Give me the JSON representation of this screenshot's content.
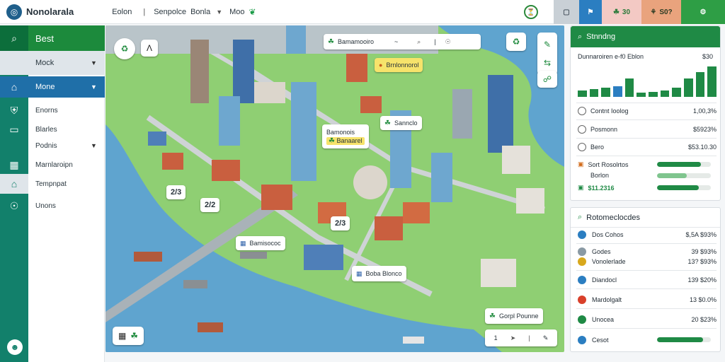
{
  "app": {
    "title": "Nonolarala"
  },
  "topnav": {
    "item1": "Eolon",
    "item2": "Senpolce",
    "item3": "Bonla",
    "item4": "Moo"
  },
  "toolbar": {
    "pink_label": "30",
    "orange_label": "S0?",
    "colors": {
      "gray": "#c9d0d6",
      "blue": "#2b7ec1",
      "pink": "#f3c9c4",
      "orange": "#e9a37d",
      "green": "#2e9e45"
    }
  },
  "sidebar": {
    "best": "Best",
    "mock": "Mock",
    "menu": "Mone",
    "items": [
      "Enorns",
      "Blarles",
      "Podnis",
      "Marnlaroipn",
      "Tempnpat",
      "Unons"
    ]
  },
  "map": {
    "top_pill": "Bamamooiro",
    "yellow_pill": "Brnlonnorol",
    "label_a": "Bamonois",
    "label_b": "Banaarel",
    "label_c": "Sannclo",
    "tag_1": "2/3",
    "tag_2": "2/2",
    "tag_3": "2/3",
    "label_d": "Bamisococ",
    "label_e": "Boba Blonco",
    "label_f": "Gorpl Pounne",
    "bottom_tag": "1",
    "colors": {
      "water": "#5fa4cf",
      "grass": "#8fcf73",
      "road": "#cfd3d6"
    }
  },
  "standing": {
    "title": "Stnndng",
    "subtitle": "Dunnaroiren e-f0 Eblon",
    "subvalue": "$30",
    "bars_relative": [
      0.18,
      0.22,
      0.28,
      0.32,
      0.55,
      0.12,
      0.14,
      0.18,
      0.28,
      0.55,
      0.72,
      0.9
    ],
    "bar_colors": [
      "#1f8a45",
      "#1f8a45",
      "#1f8a45",
      "#2b7ec1",
      "#1f8a45",
      "#1f8a45",
      "#1f8a45",
      "#1f8a45",
      "#1f8a45",
      "#1f8a45",
      "#1f8a45",
      "#1f8a45"
    ],
    "rows": [
      {
        "label": "Contnt Ioolog",
        "value": "1,00,3%"
      },
      {
        "label": "Posmonn",
        "value": "$5923%"
      },
      {
        "label": "Bero",
        "value": "$53.10.30"
      }
    ],
    "progress_label_a": "Sort Rosolrtos",
    "progress_label_b": "Borlon",
    "progress_value": "$11.2316",
    "progress_levels": [
      0.82,
      0.55,
      0.78
    ]
  },
  "list": {
    "title": "Rotomeclocdes",
    "rows": [
      {
        "label": "Dos Cohos",
        "value": "$,5A $93%",
        "color": "#2b7ec1"
      },
      {
        "label": "Godes",
        "value": "39 $93%",
        "color": "#8a9aa4"
      },
      {
        "label": "Vonolerlade",
        "value": "13? $93%",
        "color": "#d8a81c"
      },
      {
        "label": "Diandocl",
        "value": "139 $20%",
        "color": "#2b7ec1"
      },
      {
        "label": "Mardolgalt",
        "value": "13 $0.0%",
        "color": "#d9402b"
      },
      {
        "label": "Unocea",
        "value": "20 $23%",
        "color": "#1f8a45"
      },
      {
        "label": "Cesot",
        "value": "",
        "color": "#2b7ec1"
      }
    ],
    "last_progress": 0.85
  }
}
